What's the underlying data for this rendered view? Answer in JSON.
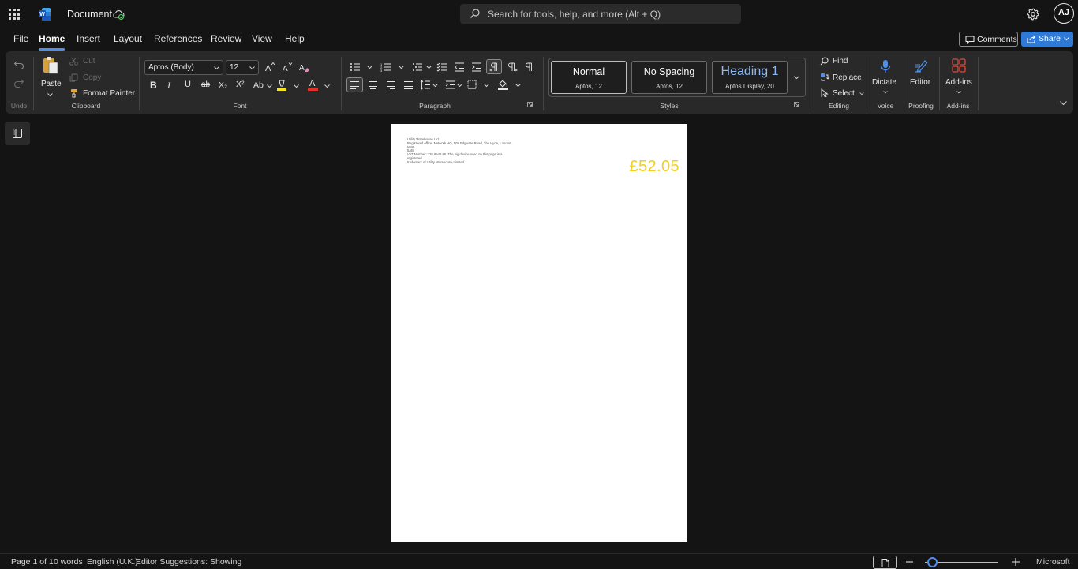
{
  "titlebar": {
    "doc_title": "Document",
    "search_placeholder": "Search for tools, help, and more (Alt + Q)",
    "avatar_initials": "AJ"
  },
  "menu": {
    "tabs": [
      "File",
      "Home",
      "Insert",
      "Layout",
      "References",
      "Review",
      "View",
      "Help"
    ],
    "active_tab": "Home",
    "comments_label": "Comments",
    "share_label": "Share"
  },
  "ribbon": {
    "undo": {
      "label": "Undo"
    },
    "clipboard": {
      "label": "Clipboard",
      "paste": "Paste",
      "cut": "Cut",
      "copy": "Copy",
      "format_painter": "Format Painter"
    },
    "font": {
      "label": "Font",
      "font_name": "Aptos (Body)",
      "font_size": "12",
      "bold": "B",
      "italic": "I",
      "underline": "U",
      "strike": "ab",
      "subscript": "X₂",
      "superscript": "X²",
      "change_case": "Ab",
      "font_color_glyph": "A"
    },
    "paragraph": {
      "label": "Paragraph"
    },
    "styles": {
      "label": "Styles",
      "items": [
        {
          "name": "Normal",
          "font": "Aptos, 12"
        },
        {
          "name": "No Spacing",
          "font": "Aptos, 12"
        },
        {
          "name": "Heading 1",
          "font": "Aptos Display, 20"
        }
      ]
    },
    "editing": {
      "label": "Editing",
      "find": "Find",
      "replace": "Replace",
      "select": "Select"
    },
    "voice": {
      "label": "Voice",
      "dictate": "Dictate"
    },
    "proofing": {
      "label": "Proofing",
      "editor": "Editor"
    },
    "addins": {
      "label": "Add-ins",
      "addins_btn": "Add-ins"
    }
  },
  "document": {
    "line1": "Utility Warehouse Ltd.",
    "line2": "Registered office: Network HQ, 508 Edgware Road, The Hyde, London. NW9",
    "line3": "5AB",
    "line4": "VAT Number: 135 9549 86. The pig device used on this page is a registered",
    "line5": "trademark of  Utility Warehouse Limited.",
    "amount": "£52.05"
  },
  "statusbar": {
    "page": "Page 1 of 1",
    "words": "0 words",
    "language": "English (U.K.)",
    "editor_suggestions": "Editor Suggestions: Showing",
    "zoom_fraction": 0.08,
    "brand": "Microsoft"
  },
  "colors": {
    "accent": "#2f7ad6",
    "amount": "#f2cf20",
    "font_color_bar": "#e0312b",
    "highlight_bar": "#f5e222"
  }
}
